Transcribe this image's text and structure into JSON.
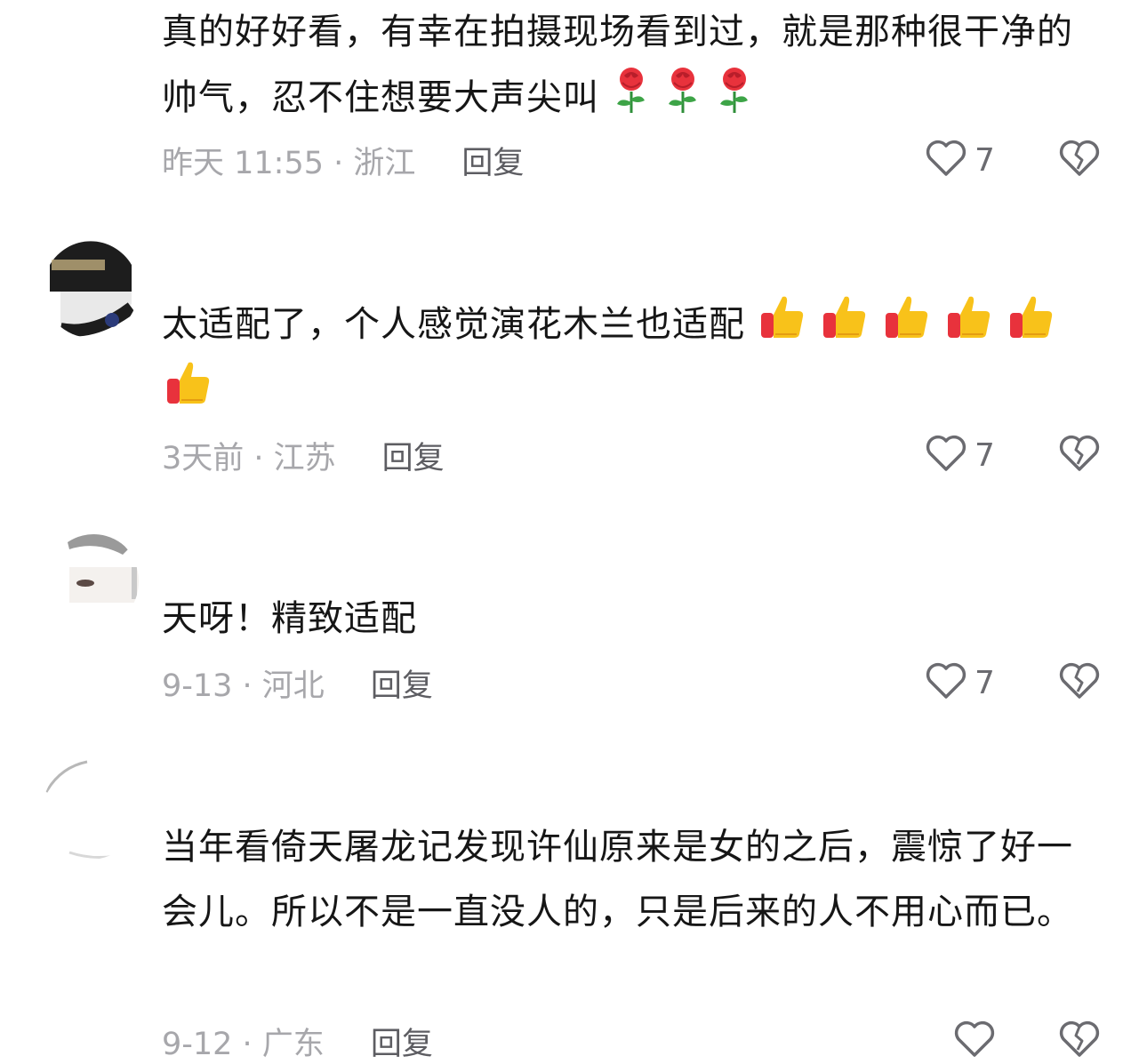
{
  "comments": [
    {
      "text": "真的好好看，有幸在拍摄现场看到过，就是那种很干净的帅气，忍不住想要大声尖叫",
      "emoji": "rose-icon",
      "emoji_count": 3,
      "time_location": "昨天 11:55 · 浙江",
      "reply_label": "回复",
      "likes": "7"
    },
    {
      "text": "太适配了，个人感觉演花木兰也适配",
      "emoji": "thumbs-up-icon",
      "emoji_count": 6,
      "time_location": "3天前 · 江苏",
      "reply_label": "回复",
      "likes": "7"
    },
    {
      "text": "天呀！精致适配",
      "time_location": "9-13 · 河北",
      "reply_label": "回复",
      "likes": "7"
    },
    {
      "text": "当年看倚天屠龙记发现许仙原来是女的之后，震惊了好一会儿。所以不是一直没人的，只是后来的人不用心而已。",
      "time_location": "9-12 · 广东",
      "reply_label": "回复"
    }
  ],
  "icons": {
    "like": "heart-outline-icon",
    "dislike": "broken-heart-icon"
  },
  "colors": {
    "meta": "#a7a7ab",
    "reply": "#5d5d62",
    "text": "#161616",
    "icon": "#6b6b70"
  }
}
